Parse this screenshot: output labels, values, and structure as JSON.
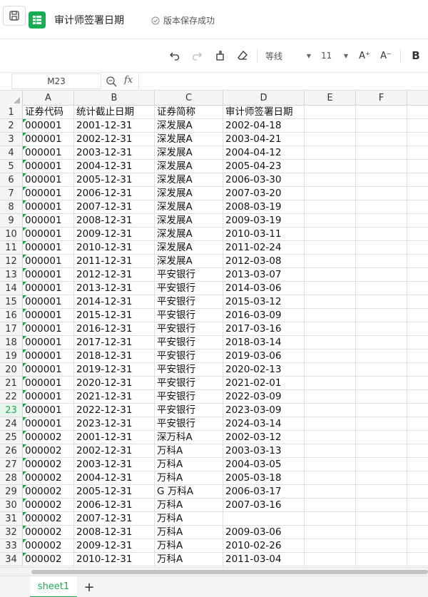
{
  "titlebar": {
    "title": "审计师签署日期",
    "save_status": "版本保存成功"
  },
  "toolbar": {
    "font_name": "等线",
    "font_size": "11",
    "grow_font_label": "A⁺",
    "shrink_font_label": "A⁻",
    "bold_label": "B"
  },
  "formula_bar": {
    "cell_ref": "M23",
    "fx_label": "fx",
    "value": ""
  },
  "active_row": 23,
  "columns": [
    "A",
    "B",
    "C",
    "D",
    "E",
    "F"
  ],
  "rows": [
    {
      "n": "1",
      "a": "证券代码",
      "b": "统计截止日期",
      "c": "证券简称",
      "d": "审计师签署日期"
    },
    {
      "n": "2",
      "a": "000001",
      "b": "2001-12-31",
      "c": "深发展A",
      "d": "2002-04-18"
    },
    {
      "n": "3",
      "a": "000001",
      "b": "2002-12-31",
      "c": "深发展A",
      "d": "2003-04-21"
    },
    {
      "n": "4",
      "a": "000001",
      "b": "2003-12-31",
      "c": "深发展A",
      "d": "2004-04-12"
    },
    {
      "n": "5",
      "a": "000001",
      "b": "2004-12-31",
      "c": "深发展A",
      "d": "2005-04-23"
    },
    {
      "n": "6",
      "a": "000001",
      "b": "2005-12-31",
      "c": "深发展A",
      "d": "2006-03-30"
    },
    {
      "n": "7",
      "a": "000001",
      "b": "2006-12-31",
      "c": "深发展A",
      "d": "2007-03-20"
    },
    {
      "n": "8",
      "a": "000001",
      "b": "2007-12-31",
      "c": "深发展A",
      "d": "2008-03-19"
    },
    {
      "n": "9",
      "a": "000001",
      "b": "2008-12-31",
      "c": "深发展A",
      "d": "2009-03-19"
    },
    {
      "n": "10",
      "a": "000001",
      "b": "2009-12-31",
      "c": "深发展A",
      "d": "2010-03-11"
    },
    {
      "n": "11",
      "a": "000001",
      "b": "2010-12-31",
      "c": "深发展A",
      "d": "2011-02-24"
    },
    {
      "n": "12",
      "a": "000001",
      "b": "2011-12-31",
      "c": "深发展A",
      "d": "2012-03-08"
    },
    {
      "n": "13",
      "a": "000001",
      "b": "2012-12-31",
      "c": "平安银行",
      "d": "2013-03-07"
    },
    {
      "n": "14",
      "a": "000001",
      "b": "2013-12-31",
      "c": "平安银行",
      "d": "2014-03-06"
    },
    {
      "n": "15",
      "a": "000001",
      "b": "2014-12-31",
      "c": "平安银行",
      "d": "2015-03-12"
    },
    {
      "n": "16",
      "a": "000001",
      "b": "2015-12-31",
      "c": "平安银行",
      "d": "2016-03-09"
    },
    {
      "n": "17",
      "a": "000001",
      "b": "2016-12-31",
      "c": "平安银行",
      "d": "2017-03-16"
    },
    {
      "n": "18",
      "a": "000001",
      "b": "2017-12-31",
      "c": "平安银行",
      "d": "2018-03-14"
    },
    {
      "n": "19",
      "a": "000001",
      "b": "2018-12-31",
      "c": "平安银行",
      "d": "2019-03-06"
    },
    {
      "n": "20",
      "a": "000001",
      "b": "2019-12-31",
      "c": "平安银行",
      "d": "2020-02-13"
    },
    {
      "n": "21",
      "a": "000001",
      "b": "2020-12-31",
      "c": "平安银行",
      "d": "2021-02-01"
    },
    {
      "n": "22",
      "a": "000001",
      "b": "2021-12-31",
      "c": "平安银行",
      "d": "2022-03-09"
    },
    {
      "n": "23",
      "a": "000001",
      "b": "2022-12-31",
      "c": "平安银行",
      "d": "2023-03-09"
    },
    {
      "n": "24",
      "a": "000001",
      "b": "2023-12-31",
      "c": "平安银行",
      "d": "2024-03-14"
    },
    {
      "n": "25",
      "a": "000002",
      "b": "2001-12-31",
      "c": "深万科A",
      "d": "2002-03-12"
    },
    {
      "n": "26",
      "a": "000002",
      "b": "2002-12-31",
      "c": "万科A",
      "d": "2003-03-13"
    },
    {
      "n": "27",
      "a": "000002",
      "b": "2003-12-31",
      "c": "万科A",
      "d": "2004-03-05"
    },
    {
      "n": "28",
      "a": "000002",
      "b": "2004-12-31",
      "c": "万科A",
      "d": "2005-03-18"
    },
    {
      "n": "29",
      "a": "000002",
      "b": "2005-12-31",
      "c": "G 万科A",
      "d": "2006-03-17"
    },
    {
      "n": "30",
      "a": "000002",
      "b": "2006-12-31",
      "c": "万科A",
      "d": "2007-03-16"
    },
    {
      "n": "31",
      "a": "000002",
      "b": "2007-12-31",
      "c": "万科A",
      "d": ""
    },
    {
      "n": "32",
      "a": "000002",
      "b": "2008-12-31",
      "c": "万科A",
      "d": "2009-03-06"
    },
    {
      "n": "33",
      "a": "000002",
      "b": "2009-12-31",
      "c": "万科A",
      "d": "2010-02-26"
    },
    {
      "n": "34",
      "a": "000002",
      "b": "2010-12-31",
      "c": "万科A",
      "d": "2011-03-04"
    }
  ],
  "sheets": [
    {
      "name": "sheet1",
      "active": true
    }
  ],
  "add_sheet_label": "+",
  "colors": {
    "accent": "#1aab55",
    "text_flag": "#1c9c4a"
  }
}
